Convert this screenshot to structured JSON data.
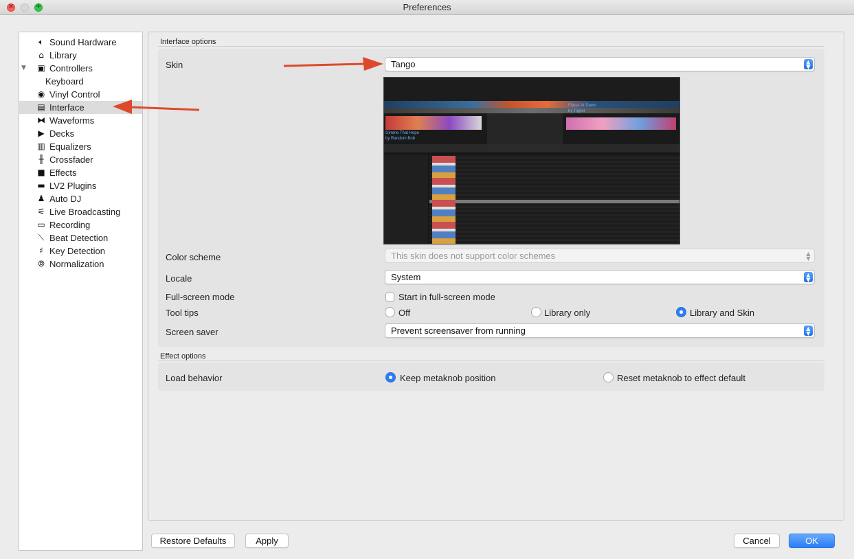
{
  "window": {
    "title": "Preferences"
  },
  "sidebar": {
    "items": [
      {
        "label": "Sound Hardware",
        "icon": "speaker-icon"
      },
      {
        "label": "Library",
        "icon": "library-icon"
      },
      {
        "label": "Controllers",
        "icon": "controller-icon"
      },
      {
        "label": "Keyboard",
        "icon": ""
      },
      {
        "label": "Vinyl Control",
        "icon": "vinyl-icon"
      },
      {
        "label": "Interface",
        "icon": "interface-icon"
      },
      {
        "label": "Waveforms",
        "icon": "waveform-icon"
      },
      {
        "label": "Decks",
        "icon": "play-icon"
      },
      {
        "label": "Equalizers",
        "icon": "equalizer-icon"
      },
      {
        "label": "Crossfader",
        "icon": "crossfader-icon"
      },
      {
        "label": "Effects",
        "icon": "effects-icon"
      },
      {
        "label": "LV2 Plugins",
        "icon": "plugin-icon"
      },
      {
        "label": "Auto DJ",
        "icon": "robot-icon"
      },
      {
        "label": "Live Broadcasting",
        "icon": "broadcast-icon"
      },
      {
        "label": "Recording",
        "icon": "recording-icon"
      },
      {
        "label": "Beat Detection",
        "icon": "beat-icon"
      },
      {
        "label": "Key Detection",
        "icon": "key-icon"
      },
      {
        "label": "Normalization",
        "icon": "normalization-icon"
      }
    ],
    "selected": "Interface"
  },
  "interface_options": {
    "group_label": "Interface options",
    "skin": {
      "label": "Skin",
      "value": "Tango"
    },
    "color_scheme": {
      "label": "Color scheme",
      "value": "This skin does not support color schemes"
    },
    "locale": {
      "label": "Locale",
      "value": "System"
    },
    "fullscreen": {
      "label": "Full-screen mode",
      "checkbox_label": "Start in full-screen mode",
      "checked": false
    },
    "tooltips": {
      "label": "Tool tips",
      "options": [
        "Off",
        "Library only",
        "Library and Skin"
      ],
      "selected": "Library and Skin"
    },
    "screensaver": {
      "label": "Screen saver",
      "value": "Prevent screensaver from running"
    }
  },
  "effect_options": {
    "group_label": "Effect options",
    "load_behavior": {
      "label": "Load behavior",
      "options": [
        "Keep metaknob position",
        "Reset metaknob to effect default"
      ],
      "selected": "Keep metaknob position"
    }
  },
  "preview": {
    "deck_left_title": "Gimme That Hope",
    "deck_left_artist": "by Random Bob",
    "deck_right_title": "Flares At Dawn",
    "deck_right_artist": "by Tipper"
  },
  "buttons": {
    "restore_defaults": "Restore Defaults",
    "apply": "Apply",
    "cancel": "Cancel",
    "ok": "OK"
  },
  "colors": {
    "accent": "#2f7df4",
    "annotation_arrow": "#dd4a2b",
    "selection": "#dcdcdc"
  }
}
